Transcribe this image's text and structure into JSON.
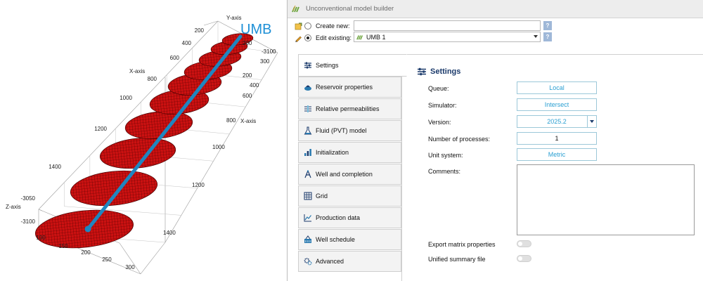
{
  "viewport": {
    "overlay_text": "UMB",
    "axes": {
      "y_axis_label": "Y-axis",
      "x_axis_label": "X-axis",
      "z_axis_label": "Z-axis",
      "x_ticks_left": [
        "200",
        "400",
        "600",
        "800",
        "1000",
        "1200",
        "1400"
      ],
      "z_ticks": [
        "-3050",
        "-3100"
      ],
      "y_ticks_bottom": [
        "100",
        "150",
        "200",
        "250",
        "300"
      ],
      "y_ticks_top": [
        "200",
        "300"
      ],
      "z_ticks_right_top": [
        "-3100"
      ],
      "x_ticks_right": [
        "200",
        "400",
        "600",
        "800",
        "1000",
        "1200",
        "1400"
      ],
      "x_axis_label_right": "X-axis"
    },
    "colors": {
      "cells": "#cc1111",
      "cells_edge": "#4a0000",
      "well": "#1f86c0"
    }
  },
  "window": {
    "title": "Unconventional model builder",
    "icon": "umb-app-icon"
  },
  "mode": {
    "create_new_label": "Create new:",
    "create_new_value": "",
    "edit_existing_label": "Edit existing:",
    "edit_existing_value": "UMB 1",
    "selected": "edit_existing",
    "help": "?"
  },
  "tabs": [
    {
      "label": "Settings",
      "icon": "sliders-icon",
      "active": true
    },
    {
      "label": "Reservoir properties",
      "icon": "reservoir-icon"
    },
    {
      "label": "Relative permeabilities",
      "icon": "relperm-icon"
    },
    {
      "label": "Fluid (PVT) model",
      "icon": "flask-icon"
    },
    {
      "label": "Initialization",
      "icon": "bar-chart-icon"
    },
    {
      "label": "Well and completion",
      "icon": "well-icon"
    },
    {
      "label": "Grid",
      "icon": "grid-icon"
    },
    {
      "label": "Production data",
      "icon": "line-chart-icon"
    },
    {
      "label": "Well schedule",
      "icon": "schedule-icon"
    },
    {
      "label": "Advanced",
      "icon": "gears-icon"
    }
  ],
  "settings": {
    "heading": "Settings",
    "queue_label": "Queue:",
    "queue_value": "Local",
    "simulator_label": "Simulator:",
    "simulator_value": "Intersect",
    "version_label": "Version:",
    "version_value": "2025.2",
    "processes_label": "Number of processes:",
    "processes_value": "1",
    "unit_label": "Unit system:",
    "unit_value": "Metric",
    "comments_label": "Comments:",
    "comments_value": "",
    "export_label": "Export matrix properties",
    "export_on": false,
    "unified_label": "Unified summary file",
    "unified_on": false
  }
}
